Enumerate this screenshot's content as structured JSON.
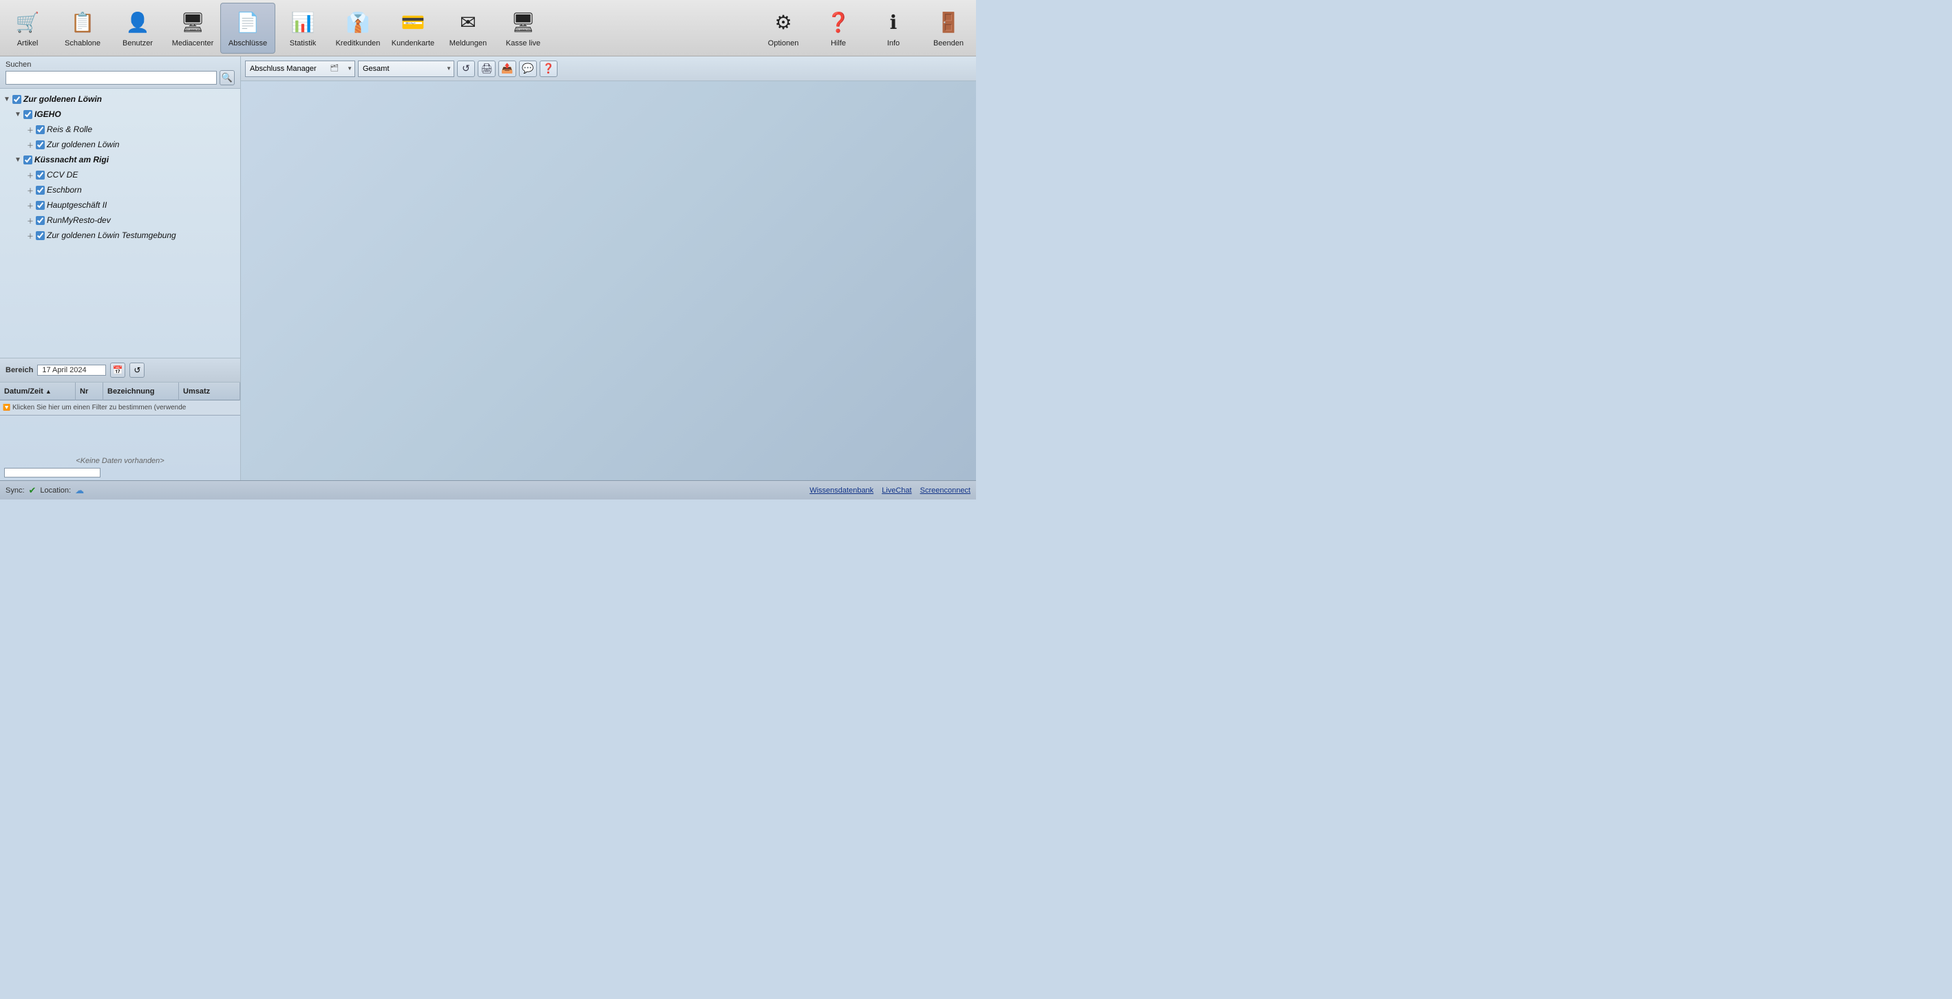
{
  "toolbar": {
    "items": [
      {
        "id": "artikel",
        "label": "Artikel",
        "icon": "🛒"
      },
      {
        "id": "schablone",
        "label": "Schablone",
        "icon": "📋"
      },
      {
        "id": "benutzer",
        "label": "Benutzer",
        "icon": "👤"
      },
      {
        "id": "mediacenter",
        "label": "Mediacenter",
        "icon": "🖥"
      },
      {
        "id": "abschlusse",
        "label": "Abschlüsse",
        "icon": "📄",
        "active": true
      },
      {
        "id": "statistik",
        "label": "Statistik",
        "icon": "📊"
      },
      {
        "id": "kreditkunden",
        "label": "Kreditkunden",
        "icon": "👔"
      },
      {
        "id": "kundenkarte",
        "label": "Kundenkarte",
        "icon": "💳"
      },
      {
        "id": "meldungen",
        "label": "Meldungen",
        "icon": "✉"
      },
      {
        "id": "kasse-live",
        "label": "Kasse live",
        "icon": "🖥"
      }
    ],
    "right_items": [
      {
        "id": "optionen",
        "label": "Optionen",
        "icon": "⚙"
      },
      {
        "id": "hilfe",
        "label": "Hilfe",
        "icon": "❓"
      },
      {
        "id": "info",
        "label": "Info",
        "icon": "ℹ"
      },
      {
        "id": "beenden",
        "label": "Beenden",
        "icon": "🚪"
      }
    ]
  },
  "sidebar": {
    "search_label": "Suchen",
    "search_placeholder": "",
    "tree": {
      "root_label": "Zur goldenen Löwin",
      "root_checked": true,
      "nodes": [
        {
          "id": "igeho",
          "label": "IGEHO",
          "level": 1,
          "checked": true,
          "expanded": true,
          "bold": true,
          "children": [
            {
              "id": "reis-rolle",
              "label": "Reis & Rolle",
              "level": 2,
              "checked": true,
              "expandable": true
            },
            {
              "id": "zur-goldenen-lowin",
              "label": "Zur goldenen Löwin",
              "level": 2,
              "checked": true,
              "expandable": true
            }
          ]
        },
        {
          "id": "kussnacht",
          "label": "Küssnacht am Rigi",
          "level": 1,
          "checked": true,
          "expanded": true,
          "bold": true,
          "children": [
            {
              "id": "ccv-de",
              "label": "CCV DE",
              "level": 2,
              "checked": true,
              "expandable": true
            },
            {
              "id": "eschborn",
              "label": "Eschborn",
              "level": 2,
              "checked": true,
              "expandable": true
            },
            {
              "id": "hauptgeschaft",
              "label": "Hauptgeschäft II",
              "level": 2,
              "checked": true,
              "expandable": true
            },
            {
              "id": "runmyresto",
              "label": "RunMyResto-dev",
              "level": 2,
              "checked": true,
              "expandable": true
            },
            {
              "id": "testumgebung",
              "label": "Zur goldenen Löwin Testumgebung",
              "level": 2,
              "checked": true,
              "expandable": true
            }
          ]
        }
      ]
    },
    "bereich_label": "Bereich",
    "bereich_date": "17 April 2024",
    "table_headers": [
      {
        "id": "datetime",
        "label": "Datum/Zeit",
        "sortable": true,
        "sort_dir": "asc"
      },
      {
        "id": "nr",
        "label": "Nr"
      },
      {
        "id": "bezeichnung",
        "label": "Bezeichnung"
      },
      {
        "id": "umsatz",
        "label": "Umsatz"
      }
    ],
    "filter_hint": "Klicken Sie hier um einen Filter zu bestimmen (verwende",
    "no_data": "<Keine Daten vorhanden>"
  },
  "content": {
    "module_select_value": "Abschluss Manager",
    "module_select_options": [
      "Abschluss Manager"
    ],
    "gesamt_select_value": "Gesamt",
    "gesamt_select_options": [
      "Gesamt"
    ],
    "toolbar_buttons": [
      {
        "id": "refresh",
        "icon": "↺",
        "title": "Aktualisieren"
      },
      {
        "id": "print",
        "icon": "🖨",
        "title": "Drucken"
      },
      {
        "id": "export",
        "icon": "📤",
        "title": "Exportieren"
      },
      {
        "id": "comment",
        "icon": "💬",
        "title": "Kommentar"
      },
      {
        "id": "help",
        "icon": "❓",
        "title": "Hilfe"
      }
    ]
  },
  "statusbar": {
    "sync_label": "Sync:",
    "sync_icon": "✔",
    "location_label": "Location:",
    "location_icon": "☁",
    "links": [
      {
        "id": "wissensdatenbank",
        "label": "Wissensdatenbank"
      },
      {
        "id": "livechat",
        "label": "LiveChat"
      },
      {
        "id": "screenconnect",
        "label": "Screenconnect"
      }
    ]
  }
}
